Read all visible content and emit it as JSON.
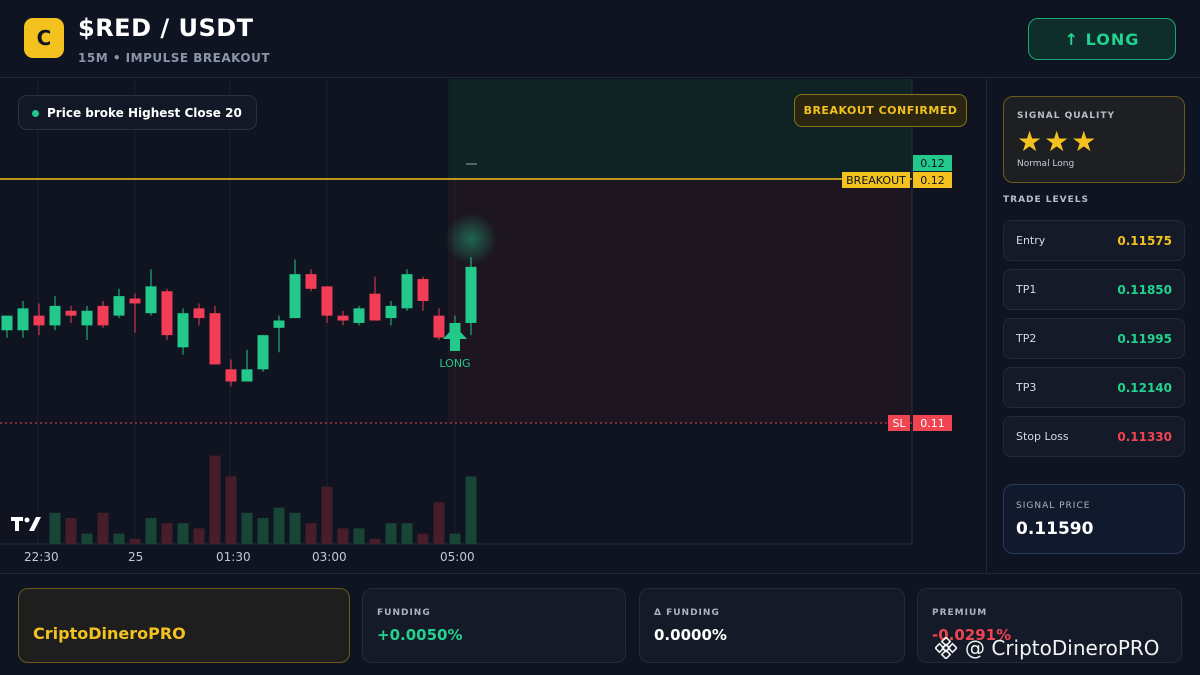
{
  "header": {
    "logo_letter": "C",
    "pair": "$RED / USDT",
    "subtitle": "15M • IMPULSE BREAKOUT",
    "long_button": "↑ LONG"
  },
  "chart": {
    "signal_text": "Price broke Highest Close 20",
    "breakout_badge": "BREAKOUT CONFIRMED",
    "last_price_tag": "0.12",
    "breakout_label": "BREAKOUT",
    "breakout_value": "0.12",
    "sl_label": "SL",
    "sl_value": "0.11",
    "long_marker": "LONG",
    "watermark_logo": "TV",
    "time_labels": [
      "22:30",
      "25",
      "01:30",
      "03:00",
      "05:00"
    ],
    "colors": {
      "up": "#22c98a",
      "down": "#f23d56",
      "breakout": "#f4c21e",
      "sl": "#f04452"
    }
  },
  "chart_data": {
    "type": "candlestick",
    "price_range": [
      0.11,
      0.12
    ],
    "breakout_level": 0.12,
    "stop_loss": 0.11,
    "candles": [
      {
        "o": 0.1138,
        "h": 0.1143,
        "l": 0.1135,
        "c": 0.1144,
        "v": 0
      },
      {
        "o": 0.1138,
        "h": 0.115,
        "l": 0.1135,
        "c": 0.1147,
        "v": 0
      },
      {
        "o": 0.1144,
        "h": 0.1149,
        "l": 0.1136,
        "c": 0.114,
        "v": 0
      },
      {
        "o": 0.114,
        "h": 0.1152,
        "l": 0.1138,
        "c": 0.1148,
        "v": 6
      },
      {
        "o": 0.1146,
        "h": 0.1148,
        "l": 0.1141,
        "c": 0.1144,
        "v": 5
      },
      {
        "o": 0.114,
        "h": 0.1148,
        "l": 0.1134,
        "c": 0.1146,
        "v": 2
      },
      {
        "o": 0.1148,
        "h": 0.115,
        "l": 0.1139,
        "c": 0.114,
        "v": 6
      },
      {
        "o": 0.1144,
        "h": 0.1155,
        "l": 0.1143,
        "c": 0.1152,
        "v": 2
      },
      {
        "o": 0.1151,
        "h": 0.1153,
        "l": 0.1137,
        "c": 0.1149,
        "v": 1
      },
      {
        "o": 0.1145,
        "h": 0.1163,
        "l": 0.1144,
        "c": 0.1156,
        "v": 5
      },
      {
        "o": 0.1154,
        "h": 0.1155,
        "l": 0.1134,
        "c": 0.1136,
        "v": 4
      },
      {
        "o": 0.1131,
        "h": 0.1147,
        "l": 0.1128,
        "c": 0.1145,
        "v": 4
      },
      {
        "o": 0.1147,
        "h": 0.1149,
        "l": 0.114,
        "c": 0.1143,
        "v": 3
      },
      {
        "o": 0.1145,
        "h": 0.1148,
        "l": 0.1124,
        "c": 0.1124,
        "v": 17
      },
      {
        "o": 0.1122,
        "h": 0.1126,
        "l": 0.1115,
        "c": 0.1117,
        "v": 13
      },
      {
        "o": 0.1117,
        "h": 0.113,
        "l": 0.1117,
        "c": 0.1122,
        "v": 6
      },
      {
        "o": 0.1122,
        "h": 0.1136,
        "l": 0.1121,
        "c": 0.1136,
        "v": 5
      },
      {
        "o": 0.1139,
        "h": 0.1144,
        "l": 0.1129,
        "c": 0.1142,
        "v": 7
      },
      {
        "o": 0.1143,
        "h": 0.1167,
        "l": 0.1143,
        "c": 0.1161,
        "v": 6
      },
      {
        "o": 0.1161,
        "h": 0.1163,
        "l": 0.1154,
        "c": 0.1155,
        "v": 4
      },
      {
        "o": 0.1156,
        "h": 0.1156,
        "l": 0.1141,
        "c": 0.1144,
        "v": 11
      },
      {
        "o": 0.1144,
        "h": 0.1146,
        "l": 0.114,
        "c": 0.1142,
        "v": 3
      },
      {
        "o": 0.1141,
        "h": 0.1148,
        "l": 0.114,
        "c": 0.1147,
        "v": 3
      },
      {
        "o": 0.1153,
        "h": 0.116,
        "l": 0.1142,
        "c": 0.1142,
        "v": 1
      },
      {
        "o": 0.1143,
        "h": 0.115,
        "l": 0.114,
        "c": 0.1148,
        "v": 4
      },
      {
        "o": 0.1147,
        "h": 0.1163,
        "l": 0.1146,
        "c": 0.1161,
        "v": 4
      },
      {
        "o": 0.1159,
        "h": 0.116,
        "l": 0.1146,
        "c": 0.115,
        "v": 2
      },
      {
        "o": 0.1144,
        "h": 0.1147,
        "l": 0.1134,
        "c": 0.1135,
        "v": 8
      },
      {
        "o": 0.1135,
        "h": 0.1144,
        "l": 0.1132,
        "c": 0.1141,
        "v": 2
      },
      {
        "o": 0.1141,
        "h": 0.1168,
        "l": 0.1136,
        "c": 0.1164,
        "v": 13
      }
    ]
  },
  "quality": {
    "title": "SIGNAL QUALITY",
    "stars": "★★★",
    "rating": 3,
    "subtitle": "Normal Long"
  },
  "levels": {
    "title": "TRADE LEVELS",
    "rows": [
      {
        "label": "Entry",
        "value": "0.11575",
        "color": "#f4c21e"
      },
      {
        "label": "TP1",
        "value": "0.11850",
        "color": "#22d38f"
      },
      {
        "label": "TP2",
        "value": "0.11995",
        "color": "#22d38f"
      },
      {
        "label": "TP3",
        "value": "0.12140",
        "color": "#22d38f"
      },
      {
        "label": "Stop Loss",
        "value": "0.11330",
        "color": "#f04452"
      }
    ]
  },
  "signal_price": {
    "title": "SIGNAL PRICE",
    "value": "0.11590"
  },
  "bottom": {
    "brand": "CriptoDineroPRO",
    "funding": {
      "title": "FUNDING",
      "value": "+0.0050%",
      "color": "#22d38f"
    },
    "delta_funding": {
      "title": "Δ FUNDING",
      "value": "0.0000%",
      "color": "#ffffff"
    },
    "premium": {
      "title": "PREMIUM",
      "value": "-0.0291%",
      "color": "#f04452"
    }
  },
  "watermark": "@ CriptoDineroPRO"
}
